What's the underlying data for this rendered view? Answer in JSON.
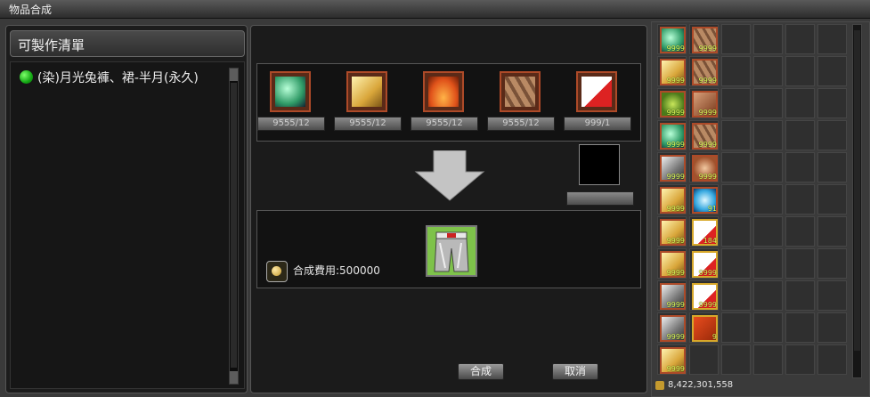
{
  "window": {
    "title": "物品合成"
  },
  "recipe_list": {
    "header": "可製作清單",
    "items": [
      {
        "label": "(染)月光兔褲、裙-半月(永久)"
      }
    ]
  },
  "materials": [
    {
      "icon": "green-gem-icon",
      "count": "9555/12"
    },
    {
      "icon": "gold-cloth-icon",
      "count": "9555/12"
    },
    {
      "icon": "orange-dye-powder-icon",
      "count": "9555/12"
    },
    {
      "icon": "wood-plank-icon",
      "count": "9555/12"
    },
    {
      "icon": "c-grade-coupon-icon",
      "count": "999/1"
    }
  ],
  "result": {
    "icon": "moon-rabbit-pants-icon",
    "cost_label": "合成費用:500000"
  },
  "buttons": {
    "craft": "合成",
    "cancel": "取消"
  },
  "inventory": {
    "items": [
      {
        "icon": "green-gem-icon",
        "qty": "9999"
      },
      {
        "icon": "wood-plank-icon",
        "qty": "9999"
      },
      {
        "icon": "gold-cloth-icon",
        "qty": "9999"
      },
      {
        "icon": "wood-plank-icon",
        "qty": "9999"
      },
      {
        "icon": "green-herb-icon",
        "qty": "9999"
      },
      {
        "icon": "dark-wood-icon",
        "qty": "9999"
      },
      {
        "icon": "green-gem-icon",
        "qty": "9999"
      },
      {
        "icon": "wood-plank-icon",
        "qty": "9999"
      },
      {
        "icon": "silver-ore-icon",
        "qty": "9999"
      },
      {
        "icon": "leather-roll-icon",
        "qty": "9999"
      },
      {
        "icon": "gold-cloth-icon",
        "qty": "9999"
      },
      {
        "icon": "blue-crystal-icon",
        "qty": "91"
      },
      {
        "icon": "gold-cloth-icon",
        "qty": "9999"
      },
      {
        "icon": "b-grade-coupon-icon",
        "qty": "184"
      },
      {
        "icon": "gold-cloth-icon",
        "qty": "9999"
      },
      {
        "icon": "a-grade-coupon-icon",
        "qty": "9999"
      },
      {
        "icon": "silver-ore-icon",
        "qty": "9999"
      },
      {
        "icon": "s-grade-coupon-icon",
        "qty": "9999"
      },
      {
        "icon": "silver-ore-icon",
        "qty": "9999"
      },
      {
        "icon": "b-grade-ticket-icon",
        "qty": "9"
      },
      {
        "icon": "gold-cloth-icon",
        "qty": "9999"
      }
    ],
    "money": "8,422,301,558"
  },
  "colors": {
    "frame_orange": "#ad4a28",
    "frame_gold": "#d7a82a",
    "qty_yellow": "#e0ff5a",
    "status_green": "#14a814"
  }
}
